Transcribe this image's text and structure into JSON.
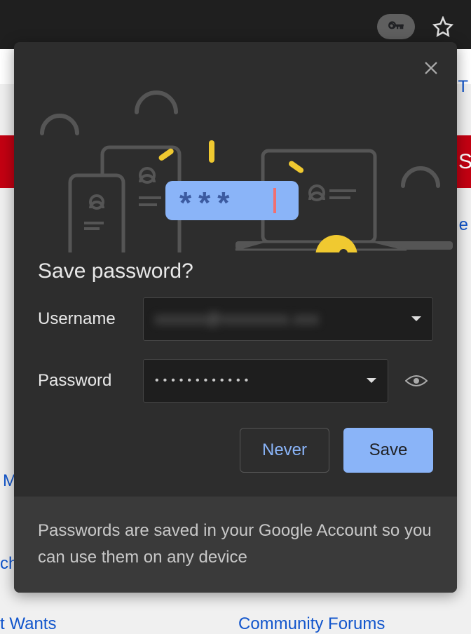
{
  "dialog": {
    "heading": "Save password?",
    "username_label": "Username",
    "password_label": "Password",
    "username_value": "",
    "password_value": "••••••••••••",
    "never_label": "Never",
    "save_label": "Save",
    "footer_text": "Passwords are saved in your Google Account so you can use them on any device"
  },
  "background": {
    "left_link_1": "M",
    "left_link_2": "ch",
    "left_link_3": "t Wants",
    "right_link_1": "T",
    "right_link_2": "e",
    "right_link_3": "Community Forums",
    "s_letter": "S"
  }
}
